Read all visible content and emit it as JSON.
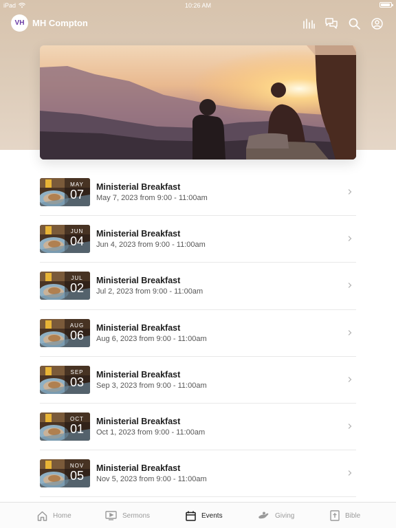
{
  "status": {
    "device": "iPad",
    "time": "10:26 AM"
  },
  "header": {
    "title": "MH Compton",
    "logo_text": "VH"
  },
  "header_icons": [
    "equalizer-icon",
    "chat-icon",
    "search-icon",
    "account-icon"
  ],
  "events": [
    {
      "title": "Ministerial Breakfast",
      "month": "MAY",
      "day": "07",
      "when": "May 7, 2023 from 9:00 - 11:00am"
    },
    {
      "title": "Ministerial Breakfast",
      "month": "JUN",
      "day": "04",
      "when": "Jun 4, 2023 from 9:00 - 11:00am"
    },
    {
      "title": "Ministerial Breakfast",
      "month": "JUL",
      "day": "02",
      "when": "Jul 2, 2023 from 9:00 - 11:00am"
    },
    {
      "title": "Ministerial Breakfast",
      "month": "AUG",
      "day": "06",
      "when": "Aug 6, 2023 from 9:00 - 11:00am"
    },
    {
      "title": "Ministerial Breakfast",
      "month": "SEP",
      "day": "03",
      "when": "Sep 3, 2023 from 9:00 - 11:00am"
    },
    {
      "title": "Ministerial Breakfast",
      "month": "OCT",
      "day": "01",
      "when": "Oct 1, 2023 from 9:00 - 11:00am"
    },
    {
      "title": "Ministerial Breakfast",
      "month": "NOV",
      "day": "05",
      "when": "Nov 5, 2023 from 9:00 - 11:00am"
    }
  ],
  "tabs": [
    {
      "label": "Home",
      "icon": "home-icon",
      "active": false
    },
    {
      "label": "Sermons",
      "icon": "tv-icon",
      "active": false
    },
    {
      "label": "Events",
      "icon": "calendar-icon",
      "active": true
    },
    {
      "label": "Giving",
      "icon": "giving-icon",
      "active": false
    },
    {
      "label": "Bible",
      "icon": "bible-icon",
      "active": false
    }
  ],
  "colors": {
    "header_bg": "#d7c3ad",
    "active_tab": "#1a1a1a",
    "inactive_tab": "#9a9a9a"
  }
}
